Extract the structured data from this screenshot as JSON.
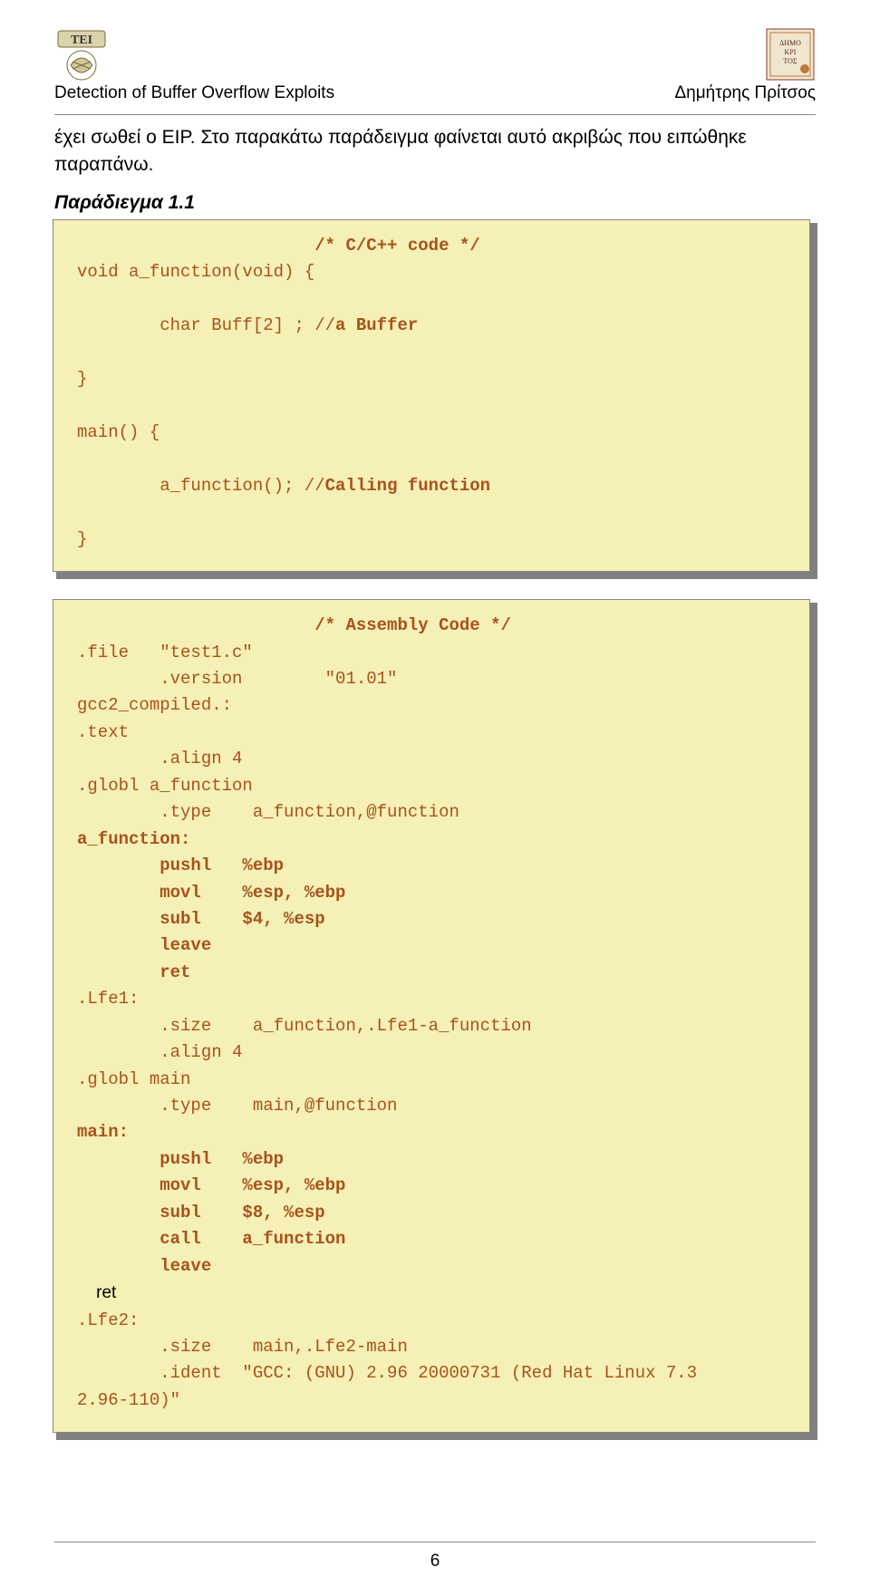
{
  "header": {
    "left_text": "Detection of Buffer Overflow Exploits",
    "right_text": "Δημήτρης Πρίτσος"
  },
  "colors": {
    "code_bg": "#f5f0b5",
    "code_text": "#a8521e",
    "shadow": "#808080"
  },
  "paragraph": {
    "line1": "έχει σωθεί ο EIP.   Στο παρακάτω παράδειγμα φαίνεται αυτό ακριβώς που ειπώθηκε",
    "line2": "παραπάνω."
  },
  "subheading": "Παράδιεγμα 1.1",
  "code1": {
    "line1": "                       /* C/C++ code */",
    "line2_a": "void a_function(void) {",
    "line3": "",
    "line4_a": "        char Buff[2] ; //",
    "line4_b": "a Buffer",
    "line5": "",
    "line6": "}",
    "line7": "",
    "line8": "main() {",
    "line9": "",
    "line10_a": "        a_function(); //",
    "line10_b": "Calling function",
    "line11": "",
    "line12": "}"
  },
  "code2": {
    "l1": "                       /* Assembly Code */",
    "l2": ".file   \"test1.c\"",
    "l3": "        .version        \"01.01\"",
    "l4": "gcc2_compiled.:",
    "l5": ".text",
    "l6": "        .align 4",
    "l7": ".globl a_function",
    "l8": "        .type    a_function,@function",
    "l9": "a_function:",
    "l10": "        pushl   %ebp",
    "l11": "        movl    %esp, %ebp",
    "l12": "        subl    $4, %esp",
    "l13": "        leave",
    "l14": "        ret",
    "l15": ".Lfe1:",
    "l16": "        .size    a_function,.Lfe1-a_function",
    "l17": "        .align 4",
    "l18": ".globl main",
    "l19": "        .type    main,@function",
    "l20": "main:",
    "l21": "        pushl   %ebp",
    "l22": "        movl    %esp, %ebp",
    "l23": "        subl    $8, %esp",
    "l24": "        call    a_function",
    "l25": "        leave",
    "l26": "    ret",
    "l27": ".Lfe2:",
    "l28": "        .size    main,.Lfe2-main",
    "l29": "        .ident  \"GCC: (GNU) 2.96 20000731 (Red Hat Linux 7.3",
    "l30": "2.96-110)\""
  },
  "footer": {
    "page": "6"
  }
}
